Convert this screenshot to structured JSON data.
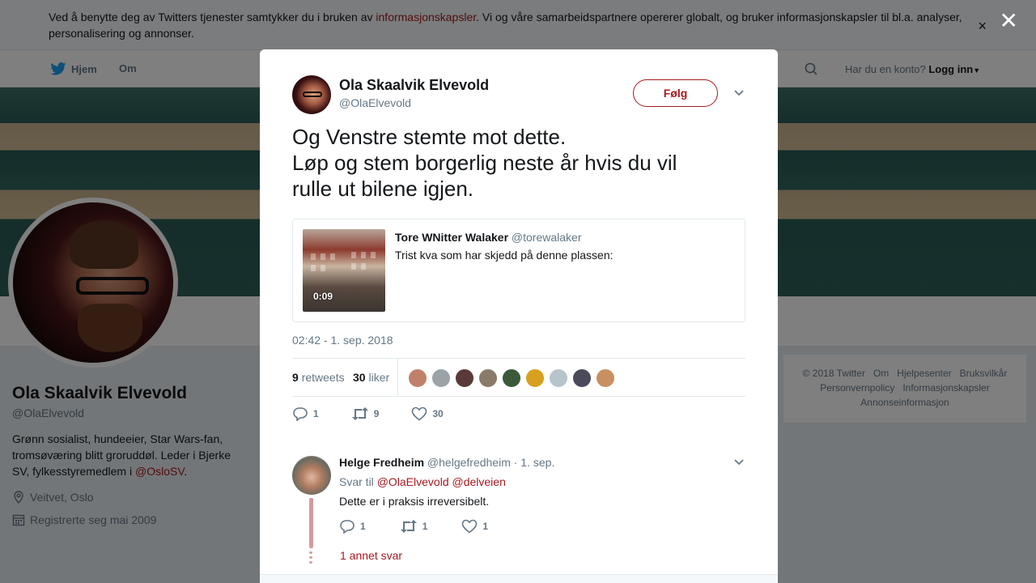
{
  "cookie": {
    "text_before": "Ved å benytte deg av Twitters tjenester samtykker du i bruken av ",
    "link": "informasjonskapsler",
    "text_after": ". Vi og våre samarbeidspartnere opererer globalt, og bruker informasjonskapsler til bl.a. analyser, personalisering og annonser.",
    "close": "×"
  },
  "nav": {
    "home": "Hjem",
    "about": "Om",
    "login_prompt": "Har du en konto?",
    "login": "Logg inn"
  },
  "overlay_close": "✕",
  "profile": {
    "name": "Ola Skaalvik Elvevold",
    "handle": "@OlaElvevold",
    "bio_text": "Grønn sosialist, hundeeier, Star Wars-fan, tromsøværing blitt groruddøl. Leder i Bjerke SV, fylkesstyremedlem i ",
    "bio_link": "@OsloSV",
    "bio_end": ".",
    "location": "Veitvet, Oslo",
    "joined": "Registrerte seg mai 2009"
  },
  "footer": {
    "links": [
      "© 2018 Twitter",
      "Om",
      "Hjelpesenter",
      "Bruksvilkår",
      "Personvernpolicy",
      "Informasjonskapsler",
      "Annonseinformasjon"
    ]
  },
  "tweet": {
    "author_name": "Ola Skaalvik Elvevold",
    "author_handle": "@OlaElvevold",
    "follow": "Følg",
    "lines": [
      "Og Venstre stemte mot dette.",
      "Løp og stem borgerlig neste år hvis du vil",
      "rulle ut bilene igjen."
    ],
    "quote": {
      "name": "Tore WNitter Walaker",
      "handle": "@torewalaker",
      "text": "Trist kva som har skjedd på denne plassen:",
      "duration": "0:09"
    },
    "timestamp": "02:42 - 1. sep. 2018",
    "retweets": "9",
    "retweets_label": "retweets",
    "likes": "30",
    "likes_label": "liker",
    "liker_colors": [
      "#c0806a",
      "#9aa3a8",
      "#5a3a38",
      "#8a7a6a",
      "#3a5a3a",
      "#d8a020",
      "#b8c4cc",
      "#4a4a5a",
      "#c89060"
    ],
    "actions": {
      "replies": "1",
      "retweets": "9",
      "likes": "30"
    }
  },
  "reply": {
    "name": "Helge Fredheim",
    "handle": "@helgefredheim",
    "date": "· 1. sep.",
    "reply_to_label": "Svar til",
    "reply_to_1": "@OlaElvevold",
    "reply_to_2": "@delveien",
    "text": "Dette er i praksis irreversibelt.",
    "actions": {
      "replies": "1",
      "retweets": "1",
      "likes": "1"
    },
    "more": "1 annet svar"
  }
}
